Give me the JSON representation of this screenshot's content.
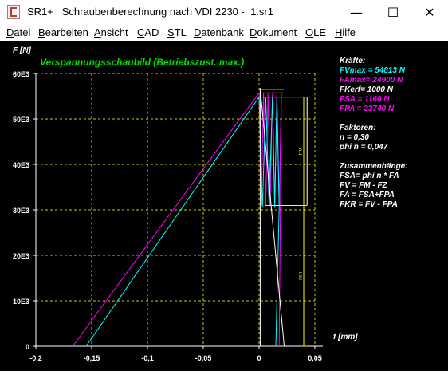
{
  "window": {
    "app_name": "SR1+",
    "title": "Schraubenberechnung nach VDI 2230",
    "file": "1.sr1",
    "minimize_glyph": "—",
    "maximize_glyph": "☐",
    "close_glyph": "✕"
  },
  "menu": [
    {
      "u": "D",
      "rest": "atei"
    },
    {
      "u": "B",
      "rest": "earbeiten"
    },
    {
      "u": "A",
      "rest": "nsicht"
    },
    {
      "u": "C",
      "rest": "AD"
    },
    {
      "u": "S",
      "rest": "TL"
    },
    {
      "u": "D",
      "rest": "atenbank"
    },
    {
      "u": "D",
      "rest": "okument"
    },
    {
      "u": "O",
      "rest": "LE"
    },
    {
      "u": "H",
      "rest": "ilfe"
    }
  ],
  "chart_data": {
    "type": "line",
    "title": "Verspannungsschaubild (Betriebszust. max.)",
    "ylabel": "F [N]",
    "xlabel": "f [mm]",
    "xlim": [
      -0.2,
      0.05
    ],
    "ylim": [
      0,
      60000
    ],
    "x_ticks": [
      "-0,2",
      "-0,15",
      "-0,1",
      "-0,05",
      "0",
      "0,05"
    ],
    "y_ticks": [
      "0",
      "10E3",
      "20E3",
      "30E3",
      "40E3",
      "50E3",
      "60E3"
    ],
    "grid": true,
    "series": [
      {
        "color": "#ff00ff",
        "values": [
          [
            -0.167,
            0
          ],
          [
            0.0,
            55713
          ],
          [
            0.002,
            31000
          ],
          [
            0.004,
            55713
          ],
          [
            0.006,
            31000
          ],
          [
            0.008,
            55713
          ],
          [
            0.01,
            31000
          ],
          [
            0.012,
            55713
          ],
          [
            0.014,
            31000
          ],
          [
            0.016,
            55713
          ],
          [
            0.018,
            31000
          ],
          [
            0.02,
            55713
          ],
          [
            0.018,
            0
          ]
        ]
      },
      {
        "color": "#00ffff",
        "values": [
          [
            -0.155,
            0
          ],
          [
            0.0,
            54813
          ],
          [
            0.003,
            30500
          ],
          [
            0.006,
            54813
          ],
          [
            0.009,
            30500
          ],
          [
            0.012,
            54813
          ],
          [
            0.014,
            30500
          ],
          [
            0.016,
            54813
          ],
          [
            0.018,
            30500
          ],
          [
            0.015,
            0
          ]
        ]
      },
      {
        "color": "#ffffff",
        "values": [
          [
            0.001,
            0
          ],
          [
            0.001,
            56800
          ],
          [
            0.0225,
            0
          ]
        ]
      }
    ],
    "bracket_labels": [
      "FPA",
      "FKR"
    ],
    "levels": {
      "fv": 54813,
      "fa_max": 55713,
      "fkr": 30973
    }
  },
  "info": {
    "kraefte_title": "Kräfte:",
    "fvmax": "FVmax    = 54813 N",
    "famax": "FAmax=  24900 N",
    "fkerf": "FKerf=    1000 N",
    "fsa": "FSA =   1160 N",
    "fpa": "FPA =  23740 N",
    "faktoren_title": "Faktoren:",
    "n": "n  =  0,30",
    "phi_n": "phi n = 0,047",
    "zus_title": "Zusammenhänge:",
    "eq1": "FSA= phi n * FA",
    "eq2": "FV = FM - FZ",
    "eq3": "FA = FSA+FPA",
    "eq4": "FKR = FV - FPA"
  }
}
